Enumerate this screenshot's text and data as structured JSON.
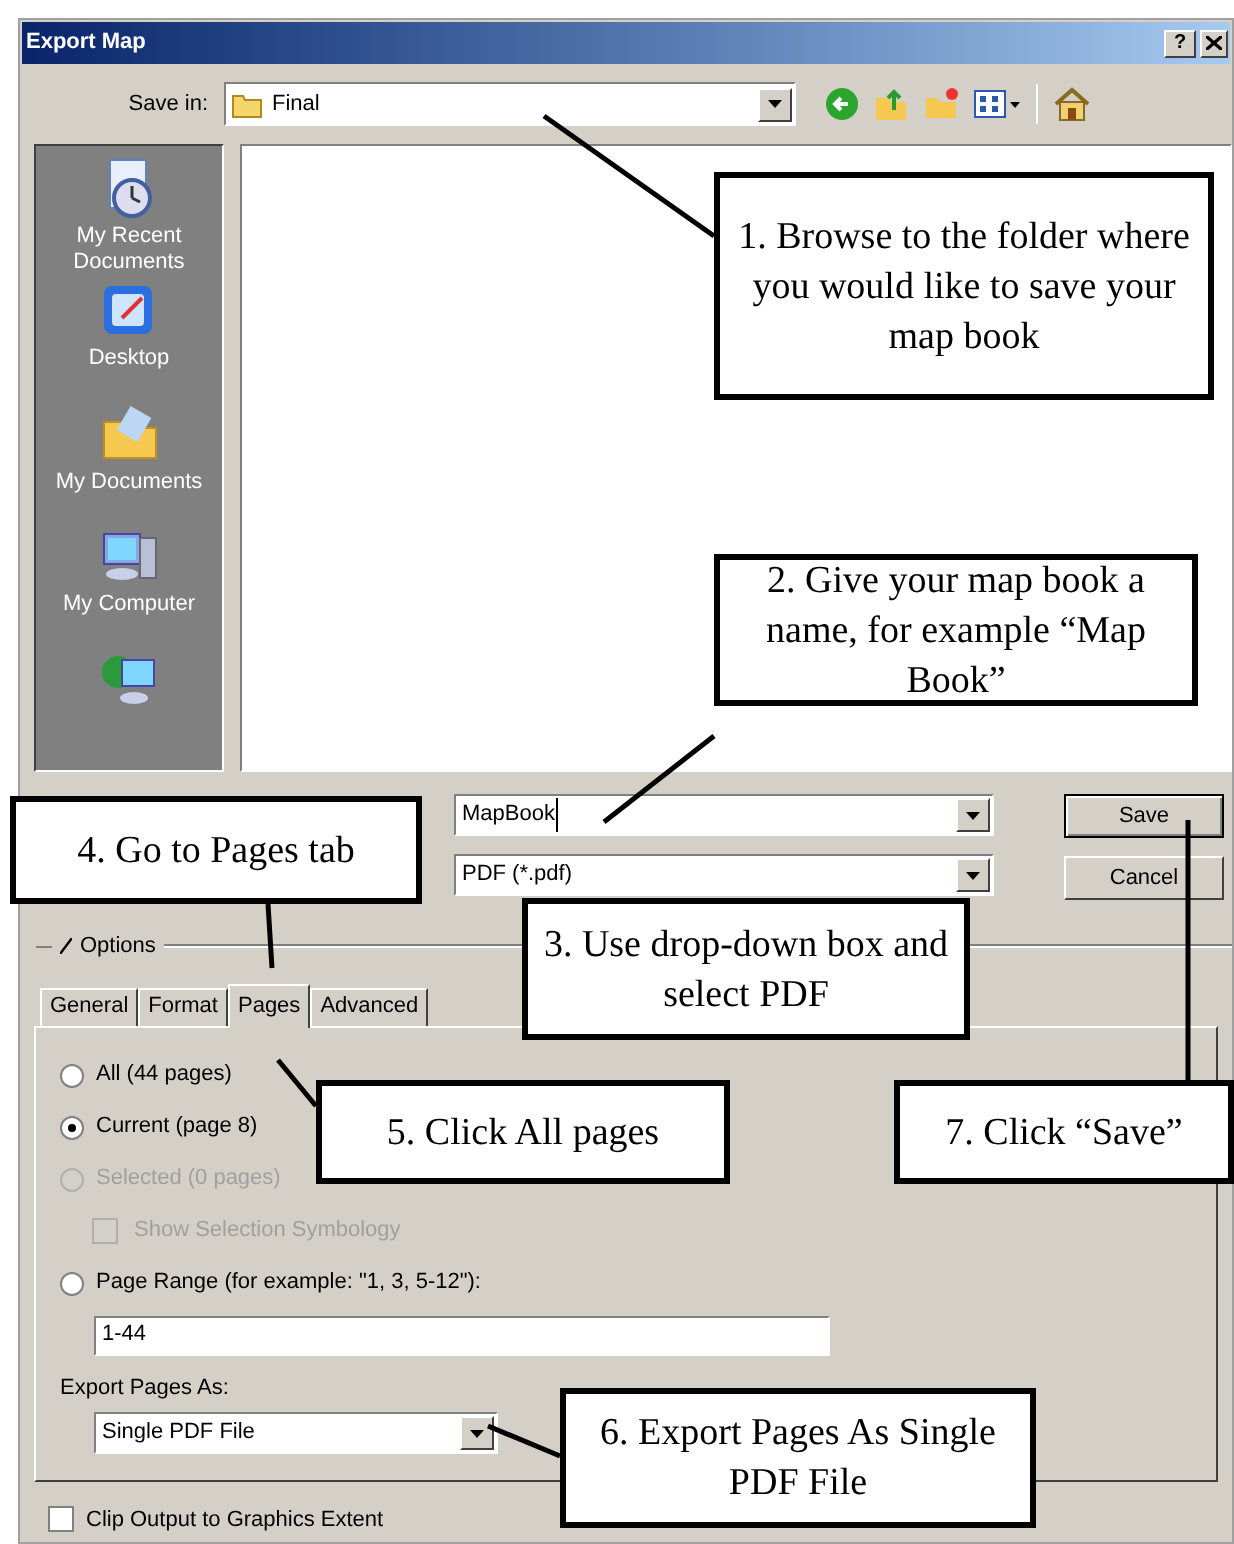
{
  "window": {
    "title": "Export Map",
    "help_button": "?"
  },
  "save_in": {
    "label": "Save in:",
    "value": "Final"
  },
  "places": [
    {
      "kind": "recent",
      "label": "My Recent Documents"
    },
    {
      "kind": "desktop",
      "label": "Desktop"
    },
    {
      "kind": "documents",
      "label": "My Documents"
    },
    {
      "kind": "computer",
      "label": "My Computer"
    },
    {
      "kind": "network"
    }
  ],
  "file_name": {
    "value": "MapBook"
  },
  "file_type": {
    "value": "PDF (*.pdf)"
  },
  "buttons": [
    {
      "label": "Save",
      "default": true
    },
    {
      "label": "Cancel",
      "default": false
    }
  ],
  "options_label": "Options",
  "tabs": [
    {
      "label": "General",
      "selected": false
    },
    {
      "label": "Format",
      "selected": false
    },
    {
      "label": "Pages",
      "selected": true
    },
    {
      "label": "Advanced",
      "selected": false
    }
  ],
  "page_options": [
    {
      "kind": "radio",
      "label": "All (44 pages)",
      "selected": false,
      "disabled": false
    },
    {
      "kind": "radio",
      "label": "Current (page 8)",
      "selected": true,
      "disabled": false
    },
    {
      "kind": "radio",
      "label": "Selected (0 pages)",
      "selected": false,
      "disabled": true
    },
    {
      "kind": "checkbox",
      "label": "Show Selection Symbology",
      "checked": false,
      "disabled": true
    },
    {
      "kind": "radio",
      "label": "Page Range (for example: \"1, 3, 5-12\"):",
      "selected": false,
      "disabled": false
    }
  ],
  "page_range": {
    "value": "1-44"
  },
  "export_pages_as": {
    "label": "Export Pages As:",
    "value": "Single PDF File"
  },
  "clip_output": {
    "label": "Clip Output to Graphics Extent",
    "checked": false
  },
  "callouts": [
    {
      "text": "1. Browse to the folder where you would like to save your map book"
    },
    {
      "text": "2. Give your map book a name, for example “Map Book”"
    },
    {
      "text": "3. Use drop-down box and select PDF"
    },
    {
      "text": "4. Go to Pages tab"
    },
    {
      "text": "5. Click All pages"
    },
    {
      "text": "6. Export Pages As Single PDF File"
    },
    {
      "text": "7. Click “Save”"
    }
  ]
}
